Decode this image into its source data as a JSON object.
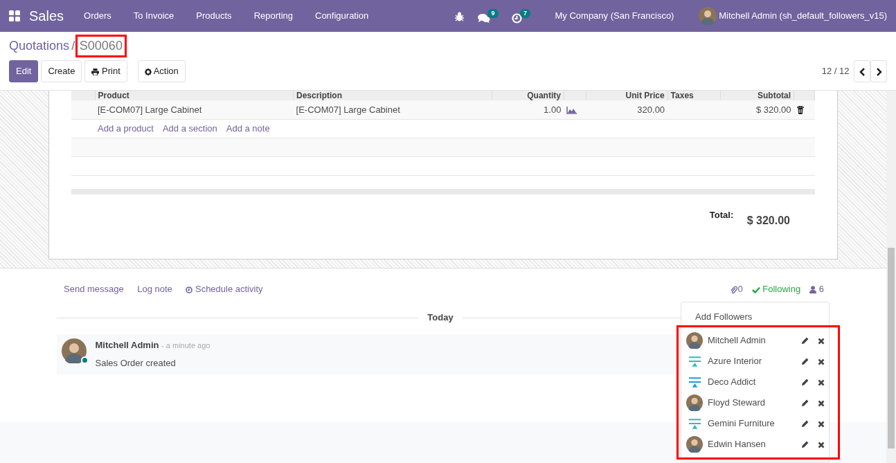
{
  "navbar": {
    "app": "Sales",
    "menus": [
      "Orders",
      "To Invoice",
      "Products",
      "Reporting",
      "Configuration"
    ],
    "discuss_badge": "9",
    "activity_badge": "7",
    "company": "My Company (San Francisco)",
    "user": "Mitchell Admin (sh_default_followers_v15)"
  },
  "breadcrumb_separator": "/",
  "breadcrumb": [
    {
      "label": "Quotations",
      "current": false,
      "highlighted": false
    },
    {
      "label": "S00060",
      "current": true,
      "highlighted": true
    }
  ],
  "buttons": [
    {
      "label": "Edit",
      "kind": "primary"
    },
    {
      "label": "Create",
      "kind": "plain"
    },
    {
      "label": "Print",
      "kind": "print"
    },
    {
      "label": "Action",
      "kind": "action"
    }
  ],
  "pager": "12 / 12",
  "order_lines": {
    "columns": [
      "Product",
      "Description",
      "Quantity",
      "Unit Price",
      "Taxes",
      "Subtotal"
    ],
    "rows": [
      {
        "product": "[E-COM07] Large Cabinet",
        "description": "[E-COM07] Large Cabinet",
        "quantity": "1.00",
        "unit_price": "320.00",
        "subtotal": "$ 320.00"
      }
    ],
    "add_links": [
      "Add a product",
      "Add a section",
      "Add a note"
    ]
  },
  "total_label": "Total:",
  "total": "$ 320.00",
  "chatter": {
    "actions": [
      "Send message",
      "Log note",
      "Schedule activity"
    ],
    "attachments": "0",
    "follow_label": "Following",
    "following": true,
    "followers_count": "6",
    "date_separator": "Today",
    "messages": [
      {
        "author": "Mitchell Admin",
        "time": "- a minute ago",
        "body": "Sales Order created",
        "online": true
      }
    ]
  },
  "followers_dropdown": {
    "add_label": "Add Followers",
    "highlighted": true,
    "followers": [
      {
        "name": "Mitchell Admin",
        "kind": "person"
      },
      {
        "name": "Azure Interior",
        "kind": "logo"
      },
      {
        "name": "Deco Addict",
        "kind": "logo"
      },
      {
        "name": "Floyd Steward",
        "kind": "person"
      },
      {
        "name": "Gemini Furniture",
        "kind": "logo"
      },
      {
        "name": "Edwin Hansen",
        "kind": "person"
      }
    ]
  }
}
